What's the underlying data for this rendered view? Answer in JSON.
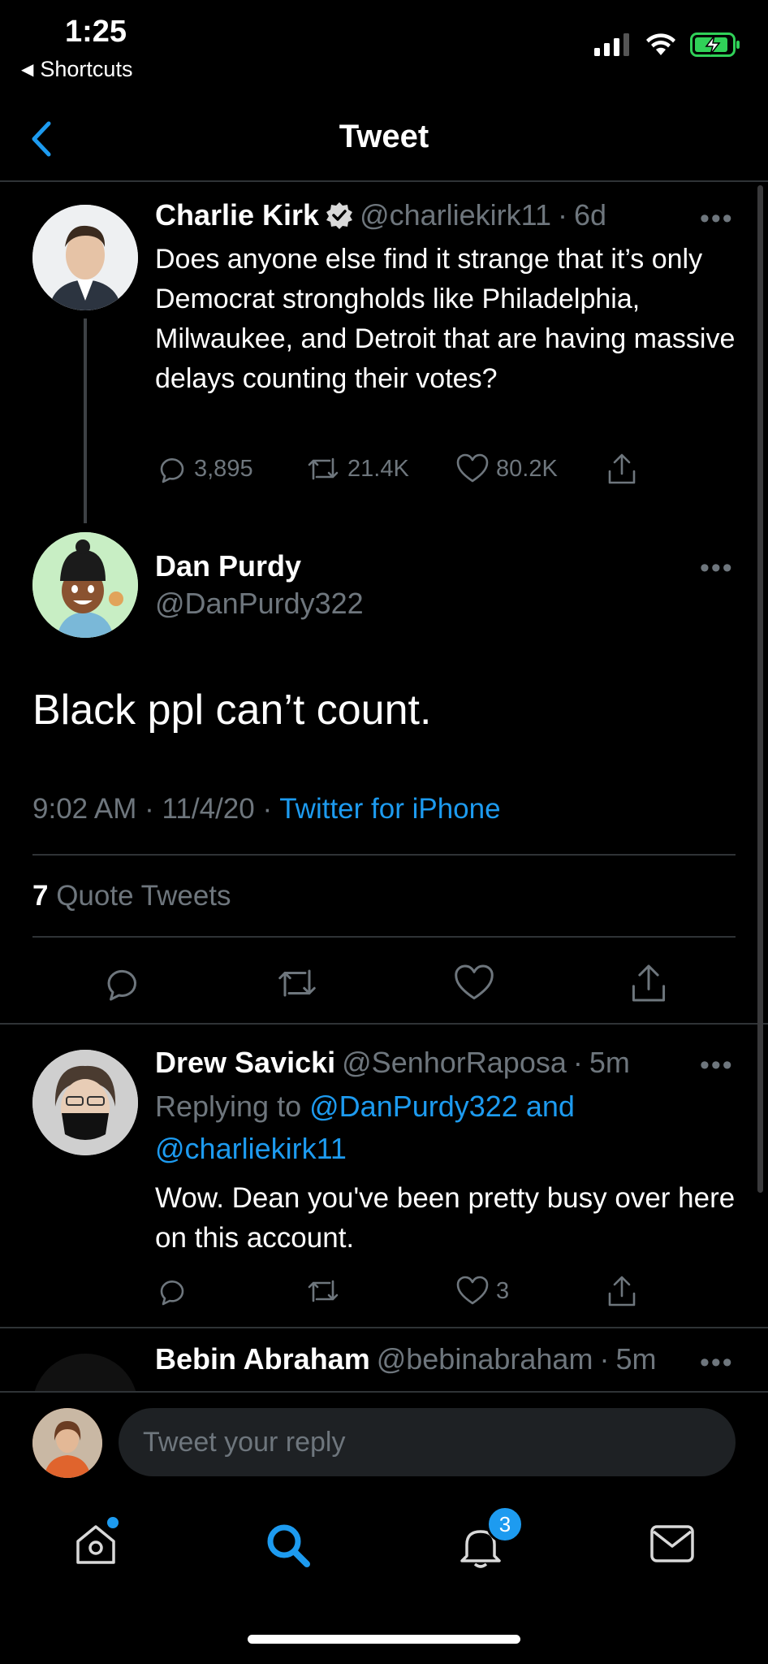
{
  "status_bar": {
    "time": "1:25",
    "back_app": "Shortcuts"
  },
  "header": {
    "title": "Tweet"
  },
  "original_tweet": {
    "name": "Charlie Kirk",
    "handle": "@charliekirk11",
    "age": "6d",
    "text": "Does anyone else find it strange that it’s only Democrat strongholds like Philadelphia, Milwaukee, and Detroit that are having massive delays counting their votes?",
    "replies": "3,895",
    "retweets": "21.4K",
    "likes": "80.2K"
  },
  "main_tweet": {
    "name": "Dan Purdy",
    "handle": "@DanPurdy322",
    "text": "Black ppl can’t count.",
    "time": "9:02 AM",
    "date": "11/4/20",
    "source": "Twitter for iPhone",
    "quote_count": "7",
    "quote_label": "Quote Tweets"
  },
  "replies": [
    {
      "name": "Drew Savicki",
      "handle": "@SenhorRaposa",
      "age": "5m",
      "replying_prefix": "Replying to",
      "replying_to_1": "@DanPurdy322 and",
      "replying_to_2": "@charliekirk11",
      "text": "Wow. Dean you've been pretty busy over here on this account.",
      "likes": "3"
    },
    {
      "name": "Bebin Abraham",
      "handle": "@bebinabraham",
      "age": "5m"
    }
  ],
  "reply_bar": {
    "placeholder": "Tweet your reply"
  },
  "tabbar": {
    "notifications_badge": "3"
  },
  "colors": {
    "accent": "#1d9bf0",
    "muted": "#6e767d",
    "divider": "#2f3336",
    "background": "#000000"
  }
}
